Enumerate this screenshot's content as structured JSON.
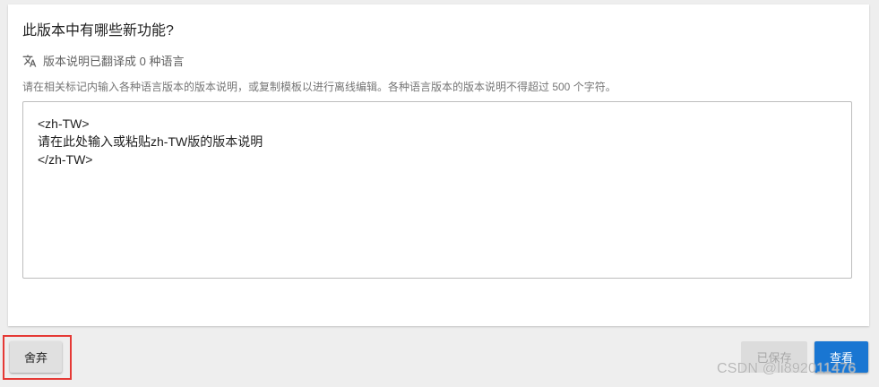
{
  "section": {
    "title": "此版本中有哪些新功能?",
    "translation_status": "版本说明已翻译成 0 种语言",
    "helper_text": "请在相关标记内输入各种语言版本的版本说明，或复制模板以进行离线编辑。各种语言版本的版本说明不得超过 500 个字符。",
    "release_notes_value": "<zh-TW>\n请在此处输入或粘贴zh-TW版的版本说明\n</zh-TW>"
  },
  "footer": {
    "discard_label": "舍弃",
    "saved_label": "已保存",
    "review_label": "查看"
  },
  "watermark": "CSDN @li892011476",
  "colors": {
    "primary": "#1976d2",
    "highlight": "#e53935"
  },
  "icons": {
    "translate": "translate-icon"
  }
}
